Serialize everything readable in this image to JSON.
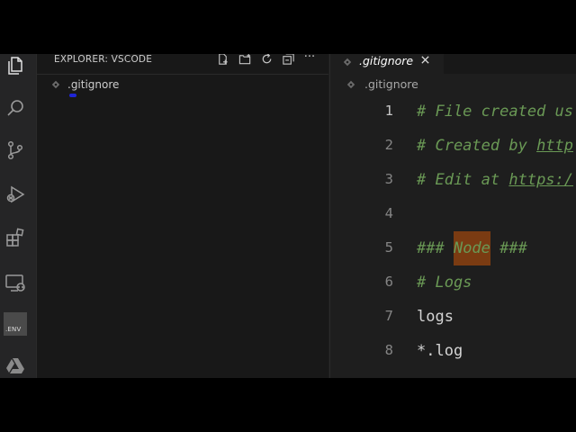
{
  "sidebar": {
    "title": "EXPLORER: VSCODE",
    "file": ".gitignore"
  },
  "tab": {
    "label": ".gitignore",
    "close": "×"
  },
  "breadcrumb": {
    "file": ".gitignore"
  },
  "activity": {
    "env_label": ".ENV"
  },
  "editor": {
    "lines": [
      {
        "n": "1",
        "pre": "# File created us",
        "link": "",
        "post": ""
      },
      {
        "n": "2",
        "pre": "# Created by ",
        "link": "http",
        "post": ""
      },
      {
        "n": "3",
        "pre": "# Edit at ",
        "link": "https:/",
        "post": ""
      },
      {
        "n": "4",
        "pre": "",
        "link": "",
        "post": ""
      },
      {
        "n": "5",
        "pre": "### ",
        "highlight": "Node",
        "post": " ###"
      },
      {
        "n": "6",
        "pre": "# Logs",
        "link": "",
        "post": ""
      },
      {
        "n": "7",
        "text": "logs"
      },
      {
        "n": "8",
        "text": "*.log"
      }
    ]
  },
  "colors": {
    "comment": "#6a9955",
    "highlight": "#7a3b12",
    "sidebar_bg": "#181818",
    "editor_bg": "#1e1e1e"
  }
}
